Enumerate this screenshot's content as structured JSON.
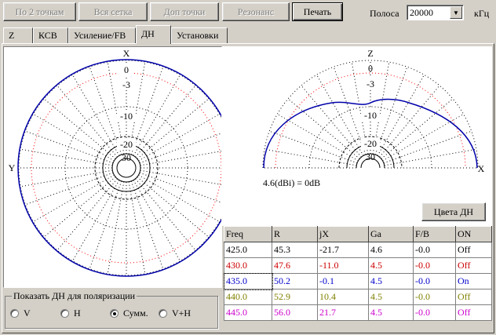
{
  "toolbar": {
    "btn_two_points": "По 2 точкам",
    "btn_all_grid": "Вся сетка",
    "btn_extra_points": "Доп точки",
    "btn_resonance": "Резонанс",
    "btn_print": "Печать",
    "band_label": "Полоса",
    "band_value": "20000",
    "band_unit": "кГц"
  },
  "tabs": [
    "Z",
    "КСВ",
    "Усиление/FB",
    "ДН",
    "Установки"
  ],
  "active_tab": "ДН",
  "plot_left": {
    "top_label": "X",
    "side_label": "Y",
    "rings": [
      "0",
      "-3",
      "-10",
      "-20",
      "30"
    ]
  },
  "plot_right": {
    "top_label": "Z",
    "side_label": "X",
    "rings": [
      "0",
      "-3",
      "-10",
      "-20",
      "30"
    ],
    "gain_note": "4.6(dBi) = 0dB",
    "colors_button": "Цвета ДН"
  },
  "polarization": {
    "title": "Показать ДН для поляризации",
    "options": [
      "V",
      "H",
      "Сумм.",
      "V+H"
    ],
    "selected": "Сумм."
  },
  "table": {
    "headers": [
      "Freq",
      "R",
      "jX",
      "Ga",
      "F/B",
      "ON"
    ],
    "rows": [
      {
        "cells": [
          "425.0",
          "45.3",
          "-21.7",
          "4.6",
          "-0.0",
          "Off"
        ],
        "color": "#000000"
      },
      {
        "cells": [
          "430.0",
          "47.6",
          "-11.0",
          "4.5",
          "-0.0",
          "Off"
        ],
        "color": "#cc0000"
      },
      {
        "cells": [
          "435.0",
          "50.2",
          "-0.1",
          "4.5",
          "-0.0",
          "On"
        ],
        "color": "#0000cc"
      },
      {
        "cells": [
          "440.0",
          "52.9",
          "10.4",
          "4.5",
          "-0.0",
          "Off"
        ],
        "color": "#808000"
      },
      {
        "cells": [
          "445.0",
          "56.0",
          "21.7",
          "4.5",
          "-0.0",
          "Off"
        ],
        "color": "#cc00cc"
      }
    ]
  },
  "colors": {
    "pattern": "#0000aa",
    "ring_red": "#ff0000"
  }
}
